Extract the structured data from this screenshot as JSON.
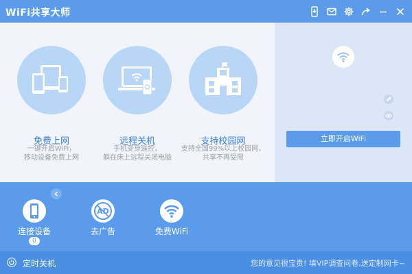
{
  "window": {
    "title": "WiFi共享大师"
  },
  "titlebar": {
    "buttons": [
      {
        "icon": "phone-download-icon"
      },
      {
        "icon": "mail-icon"
      },
      {
        "icon": "gear-icon"
      },
      {
        "icon": "share-icon"
      },
      {
        "icon": "minimize-icon"
      },
      {
        "icon": "close-icon"
      }
    ]
  },
  "features": [
    {
      "title": "免费上网",
      "desc": [
        "一键开启WiFi，",
        "移动设备免费上网"
      ],
      "icon": "devices-icon"
    },
    {
      "title": "远程关机",
      "desc": [
        "手机变身遥控，",
        "躺在床上远程关闭电脑"
      ],
      "icon": "laptop-phone-icon"
    },
    {
      "title": "支持校园网",
      "desc": [
        "支持全国99%以上校园网，",
        "共享不再受限"
      ],
      "icon": "campus-building-icon"
    }
  ],
  "right_panel": {
    "status_icon": "wifi-icon",
    "edit_icon": "pencil-icon",
    "view_icon": "eye-icon",
    "start_button": "立即开启WiFi"
  },
  "tools": [
    {
      "label": "连接设备",
      "icon": "phone-icon",
      "count": "0"
    },
    {
      "label": "去广告",
      "icon": "ad-block-icon"
    },
    {
      "label": "免费WiFi",
      "icon": "wifi-icon"
    }
  ],
  "footer": {
    "timer_label": "定时关机",
    "feedback": "您的意见很宝贵! 填VIP调查问卷,送定制网卡~"
  },
  "colors": {
    "primary": "#5b9bec",
    "footer": "#4a8fe3",
    "feature_circle": "#b8d6f6",
    "feature_title": "#3a7fd8",
    "main_bg": "#f1f5fb",
    "panel_bg": "#dbe7f7"
  }
}
